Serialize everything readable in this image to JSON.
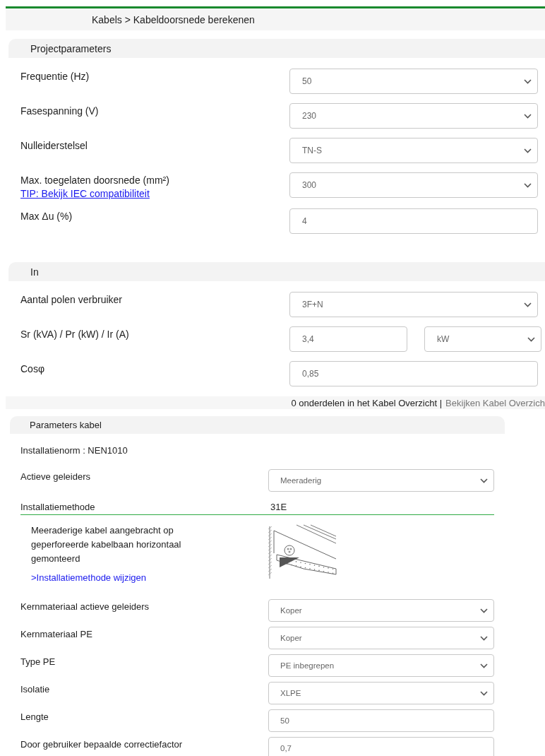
{
  "breadcrumb": "Kabels > Kabeldoorsnede berekenen",
  "sections": [
    {
      "title": "Projectparameters",
      "rows": [
        {
          "label": "Frequentie (Hz)",
          "fields": [
            {
              "kind": "select",
              "value": "50"
            }
          ]
        },
        {
          "label": "Fasespanning (V)",
          "fields": [
            {
              "kind": "select",
              "value": "230"
            }
          ]
        },
        {
          "label": "Nulleiderstelsel",
          "fields": [
            {
              "kind": "select",
              "value": "TN-S"
            }
          ]
        },
        {
          "label": "Max. toegelaten doorsnede (mm²)",
          "link": "TIP: Bekijk IEC compatibiliteit",
          "fields": [
            {
              "kind": "select",
              "value": "300"
            }
          ]
        },
        {
          "label": "Max Δu (%)",
          "fields": [
            {
              "kind": "input",
              "value": "4"
            }
          ]
        }
      ]
    },
    {
      "title": "In",
      "rows": [
        {
          "label": "Aantal polen verbruiker",
          "fields": [
            {
              "kind": "select",
              "value": "3F+N"
            }
          ]
        },
        {
          "label": "Sr (kVA) / Pr (kW) / Ir (A)",
          "fields": [
            {
              "kind": "input",
              "value": "3,4"
            },
            {
              "kind": "select",
              "value": "kW"
            }
          ]
        },
        {
          "label": "Cosφ",
          "fields": [
            {
              "kind": "input",
              "value": "0,85"
            }
          ]
        }
      ]
    }
  ],
  "overview_bar": {
    "count": "0 onderdelen in het Kabel Overzicht |",
    "link": "Bekijken Kabel Overzich"
  },
  "cable_parameters": {
    "title": "Parameters kabel",
    "norm": "Installatienorm : NEN1010",
    "rows_top": [
      {
        "label": "Actieve geleiders",
        "field": {
          "kind": "select",
          "value": "Meeraderig"
        }
      }
    ],
    "method": {
      "label": "Installatiemethode",
      "value": "31E",
      "description": "Meeraderige kabel aangebracht op geperforeerde kabelbaan horizontaal gemonteerd",
      "link": ">Installatiemethode wijzigen"
    },
    "rows": [
      {
        "label": "Kernmateriaal actieve geleiders",
        "field": {
          "kind": "select",
          "value": "Koper"
        }
      },
      {
        "label": "Kernmateriaal PE",
        "field": {
          "kind": "select",
          "value": "Koper"
        }
      },
      {
        "label": "Type PE",
        "field": {
          "kind": "select",
          "value": "PE inbegrepen"
        }
      },
      {
        "label": "Isolatie",
        "field": {
          "kind": "select",
          "value": "XLPE"
        }
      },
      {
        "label": "Lengte",
        "field": {
          "kind": "input",
          "value": "50"
        }
      },
      {
        "label": "Door gebruiker bepaalde correctiefactor",
        "field": {
          "kind": "input",
          "value": "0,7"
        }
      }
    ]
  }
}
